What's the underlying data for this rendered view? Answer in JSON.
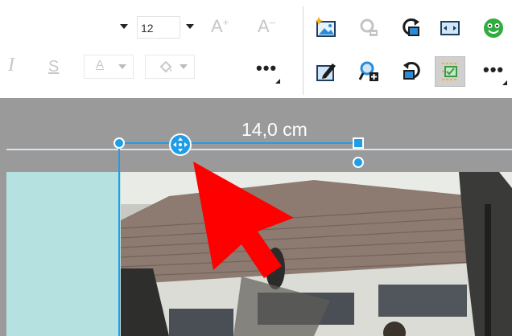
{
  "toolbar": {
    "font_size": "12",
    "grow_font": "A",
    "shrink_font": "A",
    "italic": "I",
    "strike": "S",
    "font_color_letter": "A"
  },
  "ruler": {
    "measurement": "14,0 cm"
  },
  "colors": {
    "accent": "#1f9ee8",
    "teal_area": "#b5e1e1",
    "gray_strip": "#9a9a9a",
    "pointer": "#ff0000"
  },
  "icons": [
    "insert-picture-icon",
    "remove-picture-icon",
    "rotate-right-icon",
    "fit-picture-icon",
    "smiley-icon",
    "edit-picture-icon",
    "add-picture-icon",
    "rotate-left-icon",
    "alignment-icon"
  ]
}
